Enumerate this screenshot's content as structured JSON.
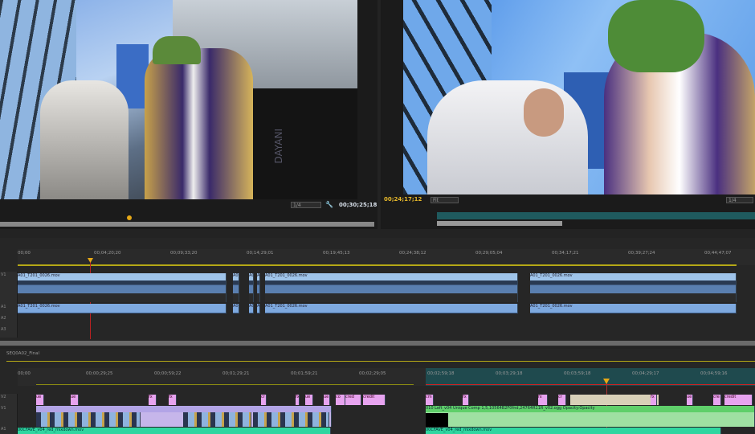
{
  "source_monitor": {
    "timecode": "00;30;25;18",
    "zoom": "1/4",
    "sign_text": "DAYANI"
  },
  "program_monitor": {
    "timecode": "00;24;17;12",
    "fit": "Fit",
    "resolution": "1/4"
  },
  "upper_timeline": {
    "ruler": [
      "00;00",
      "00;04;20;20",
      "00;09;33;20",
      "00;14;29;01",
      "00;19;45;13",
      "00;24;38;12",
      "00;29;05;04",
      "00;34;17;21",
      "00;39;27;24",
      "00;44;47;07"
    ],
    "tracks": [
      "V1",
      "A1",
      "A2",
      "A3"
    ],
    "clip_label": "A01_T201_0026.mov"
  },
  "lower_timeline": {
    "sequence_tab": "SEQ0A02_Final",
    "ruler": [
      "00;00",
      "00;00;29;25",
      "00;00;59;22",
      "00;01;29;21",
      "00;01;59;21",
      "00;02;29;05",
      "00;02;59;18",
      "00;03;29;18",
      "00;03;59;18",
      "00;04;29;17",
      "00;04;59;16"
    ],
    "tracks": [
      "V2",
      "V1",
      "A1"
    ],
    "green_clip_label": "010 Left_v04 Unique Comp 1,5,10564B2F0fnd,24764R11R_v02.ogg  Opacity:Opacity",
    "audio_clip_label": "00CFAVE_v04_red_mixdown.mov",
    "pink_labels": [
      "ue",
      "ue",
      "fx",
      "fx",
      "cr",
      "fx",
      "ue",
      "ue",
      "co",
      "cred",
      "credit",
      "cm",
      "fx",
      "fx",
      "cr",
      "fx",
      "ue",
      "cre",
      "credit"
    ]
  },
  "colors": {
    "playhead": "#e6a817",
    "video_clip": "#7ea9df",
    "adjustment_clip": "#e7a3ef",
    "green_clip": "#5fcf6a",
    "audio_clip": "#2fd6a0"
  }
}
